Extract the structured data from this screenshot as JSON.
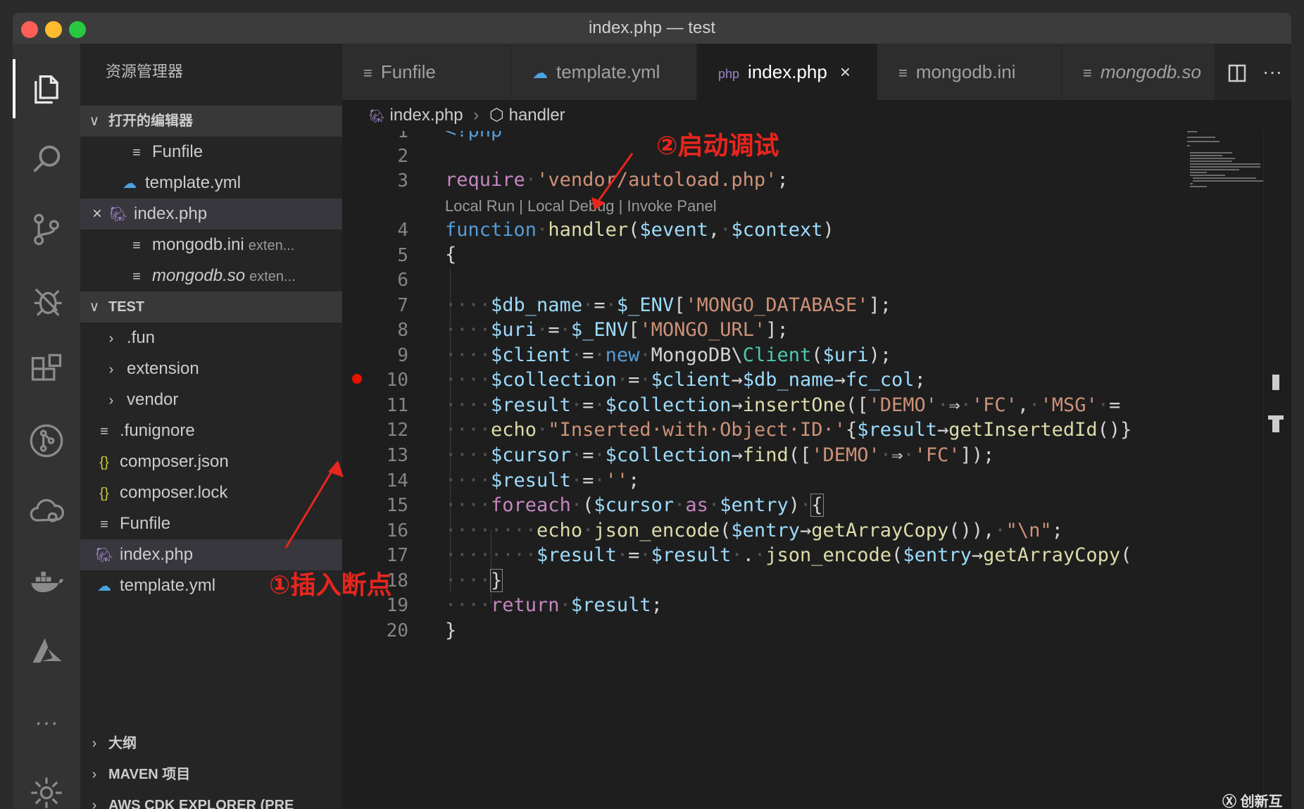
{
  "window": {
    "title": "index.php — test",
    "controls": [
      "#ff5f57",
      "#febc2e",
      "#28c840"
    ]
  },
  "activity_bar": [
    "files-icon",
    "search-icon",
    "source-control-icon",
    "debug-icon",
    "extensions-icon",
    "gitlens-icon",
    "cloud-icon",
    "docker-icon",
    "azure-icon",
    "more-icon",
    "gear-icon"
  ],
  "sidebar": {
    "title": "资源管理器",
    "open_editors": {
      "header": "打开的编辑器",
      "items": [
        {
          "name": "Funfile",
          "icon": "lines-icon"
        },
        {
          "name": "template.yml",
          "icon": "cloud-icon"
        },
        {
          "name": "index.php",
          "icon": "php-icon",
          "close": "×"
        },
        {
          "name": "mongodb.ini",
          "icon": "lines-icon",
          "desc": "exten..."
        },
        {
          "name": "mongodb.so",
          "icon": "lines-icon",
          "desc": "exten..."
        }
      ]
    },
    "workspace": {
      "header": "TEST",
      "items": [
        {
          "name": ".fun",
          "icon": ">"
        },
        {
          "name": "extension",
          "icon": ">"
        },
        {
          "name": "vendor",
          "icon": ">"
        },
        {
          "name": ".funignore",
          "icon": "≡"
        },
        {
          "name": "composer.json",
          "icon": "{}"
        },
        {
          "name": "composer.lock",
          "icon": "{}"
        },
        {
          "name": "Funfile",
          "icon": "≡"
        },
        {
          "name": "index.php",
          "icon": "php"
        },
        {
          "name": "template.yml",
          "icon": "cloud"
        }
      ]
    },
    "bottom_sections": [
      "大纲",
      "MAVEN 项目",
      "AWS CDK EXPLORER (PRE"
    ]
  },
  "tabs": [
    {
      "label": "Funfile",
      "icon": "≡"
    },
    {
      "label": "template.yml",
      "icon": "☁"
    },
    {
      "label": "index.php",
      "icon": "php",
      "close": "×"
    },
    {
      "label": "mongodb.ini",
      "icon": "≡"
    },
    {
      "label": "mongodb.so",
      "icon": "≡"
    }
  ],
  "tab_actions": [
    "split-editor-icon",
    "more-actions-icon"
  ],
  "breadcrumbs": {
    "file": "index.php",
    "symbol": "handler"
  },
  "editor": {
    "line_numbers": [
      "1",
      "2",
      "3",
      "4",
      "5",
      "6",
      "7",
      "8",
      "9",
      "10",
      "11",
      "12",
      "13",
      "14",
      "15",
      "16",
      "17",
      "18",
      "19",
      "20"
    ],
    "codelens": "Local Run | Local Debug | Invoke Panel",
    "breakpoint_line": "10"
  },
  "annotations": {
    "insert_breakpoint": "①插入断点",
    "start_debug": "②启动调试"
  },
  "watermark": "创新互联"
}
